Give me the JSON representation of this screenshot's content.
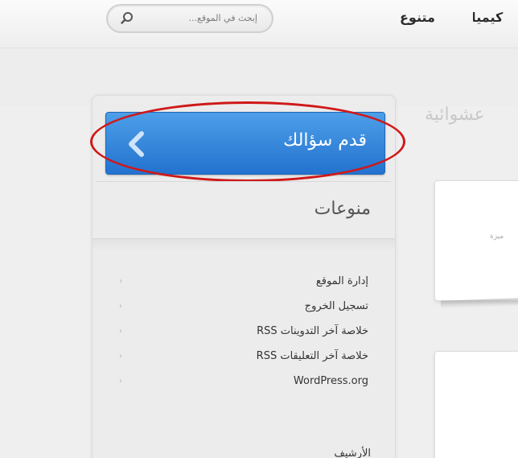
{
  "header": {
    "search_placeholder": "إبحث في الموقع...",
    "nav": [
      {
        "label": "متنوع"
      },
      {
        "label": "كيمياء"
      }
    ]
  },
  "main": {
    "random_title": "عشوائية",
    "card_snippet": "ميزة"
  },
  "sidebar": {
    "ask_button_label": "قدم سؤالك",
    "section_title": "منوعات",
    "links": [
      {
        "label": "إدارة الموقع"
      },
      {
        "label": "تسجيل الخروج"
      },
      {
        "label": "خلاصة آخر التدوينات RSS"
      },
      {
        "label": "خلاصة آخر التعليقات RSS"
      },
      {
        "label": "WordPress.org"
      }
    ],
    "next_section_partial": "الأرشيف"
  },
  "colors": {
    "button_blue": "#2f82da",
    "highlight_ring": "#d01818"
  }
}
